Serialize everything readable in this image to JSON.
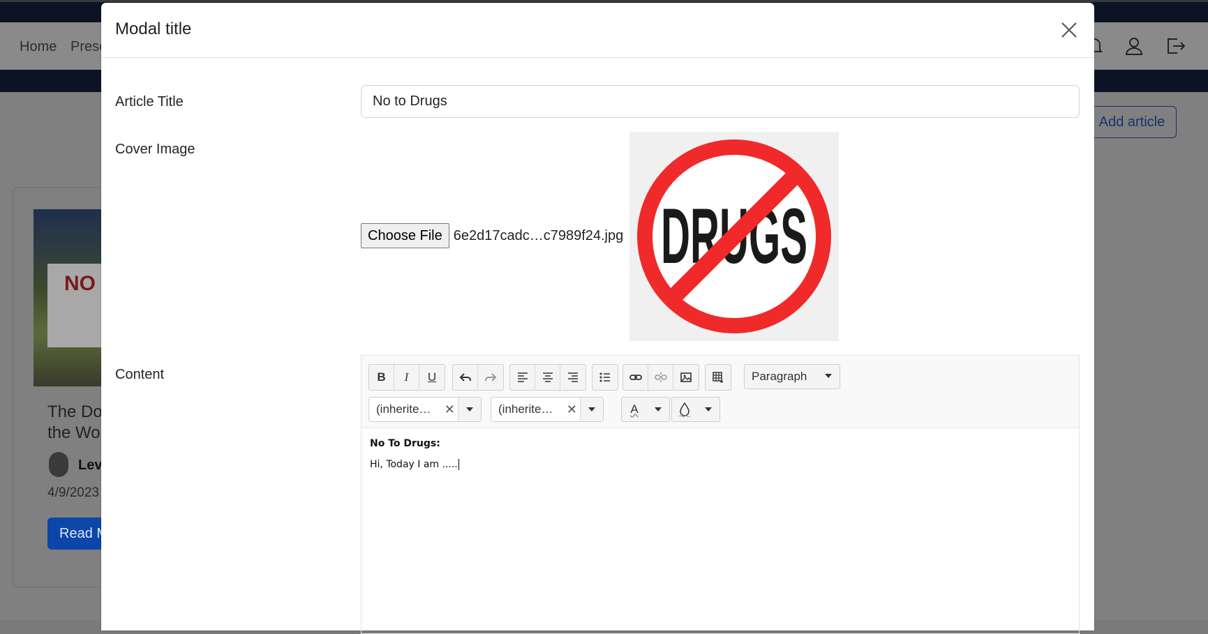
{
  "background": {
    "nav": {
      "home": "Home",
      "second": "Prese"
    },
    "add_article": "Add article",
    "card": {
      "title_line1": "The Do",
      "title_line2": "the Wo",
      "image_text": "NO",
      "author": "Lev",
      "date": "4/9/2023",
      "button": "Read M"
    }
  },
  "modal": {
    "title": "Modal title",
    "close_icon": "close-icon",
    "labels": {
      "article_title": "Article Title",
      "cover_image": "Cover Image",
      "content": "Content"
    },
    "article_title_value": "No to Drugs",
    "file_button": "Choose File",
    "file_name": "6e2d17cadc…c7989f24.jpg",
    "cover_image_text": "DRUGS",
    "editor": {
      "paragraph_label": "Paragraph",
      "font_family": "(inherite…",
      "font_size": "(inherite…",
      "font_color_letter": "A",
      "content_heading": "No To Drugs:",
      "content_line": "Hi, Today I am ....."
    }
  },
  "colors": {
    "brand_button": "#0b46a8",
    "no_symbol_red": "#f02a2a",
    "dark_nav": "#0b1324"
  }
}
